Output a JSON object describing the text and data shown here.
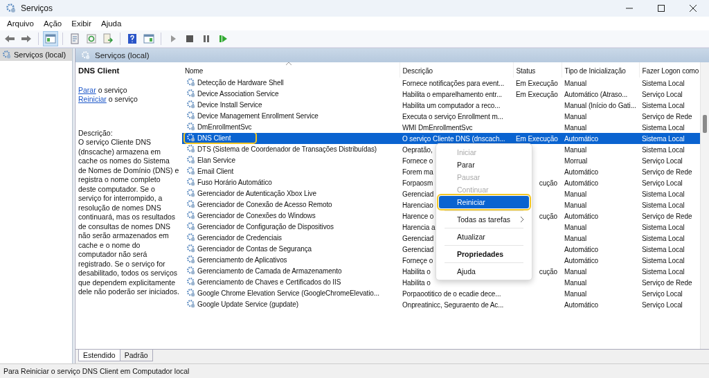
{
  "window": {
    "title": "Serviços"
  },
  "menu_bar": [
    "Arquivo",
    "Ação",
    "Exibir",
    "Ajuda"
  ],
  "tree": {
    "items": [
      {
        "label": "Serviços (local)",
        "selected": true
      }
    ]
  },
  "pane_header": "Serviços (local)",
  "details": {
    "title": "DNS Client",
    "actions": [
      {
        "link": "Parar",
        "text": "o serviço"
      },
      {
        "link": "Reiniciar",
        "text": "o serviço"
      }
    ],
    "description_label": "Descrição:",
    "description": "O serviço Cliente DNS (dnscache) armazena em cache os nomes do Sistema de Nomes de Domínio (DNS) e registra o nome completo deste computador. Se o serviço for interrompido, a resolução de nomes DNS continuará, mas os resultados de consultas de nomes DNS não serão armazenados em cache e o nome do computador não será registrado. Se o serviço for desabilitado, todos os serviços que dependem explicitamente dele não poderão ser iniciados."
  },
  "table": {
    "columns": [
      "Nome",
      "Descrição",
      "Status",
      "Tipo de Inicialização",
      "Fazer Logon como"
    ],
    "rows": [
      {
        "name": "Detecção de Hardware Shell",
        "description": "Fornece notificações para event...",
        "status": "Em Execução",
        "startup": "Manual",
        "logon": "Sistema Local",
        "selected": false
      },
      {
        "name": "Device Association Service",
        "description": "Habilita o emparelhamento entr...",
        "status": "Em Execução",
        "startup": "Automático (Atraso...",
        "logon": "Serviço Local",
        "selected": false
      },
      {
        "name": "Device Install Service",
        "description": "Habilita um computador a reco...",
        "startup": "Manual (Início do Gati...",
        "logon": "Sistema Local",
        "selected": false
      },
      {
        "name": "Device Management Enrollment Service",
        "description": "Executa o serviço Enrollment m...",
        "startup": "Manual",
        "logon": "Serviço de Rede",
        "selected": false
      },
      {
        "name": "DmEnrollmentSvc",
        "description": "WMI DmEnrollmentSvc",
        "startup": "Manual",
        "logon": "Sistema Local",
        "selected": false
      },
      {
        "name": "DNS Client",
        "description": "O serviço Cliente DNS (dnscach...",
        "status": "Em Execução",
        "startup": "Automático",
        "logon": "Sistema Local",
        "selected": true
      },
      {
        "name": "DTS (Sistema de Coordenador de Transações Distribuídas)",
        "description": "Oepratão,",
        "startup": "Manual",
        "logon": "Sistema Local",
        "selected": false
      },
      {
        "name": "Elan Service",
        "description": "Fornece o",
        "startup": "Morrual",
        "logon": "Serviço Local",
        "selected": false
      },
      {
        "name": "Email Client",
        "description": "Forem ma",
        "startup": "Automático",
        "logon": "Serviço de Rede",
        "selected": false
      },
      {
        "name": "Fuso Horário Automático",
        "description": "Forpaosm",
        "status": "cução",
        "startup": "Automático",
        "logon": "Serviço Local",
        "selected": false
      },
      {
        "name": "Gerenciador de Autenticação Xbox Live",
        "description": "Gerenciad",
        "startup": "Manual",
        "logon": "Sistema Local",
        "selected": false
      },
      {
        "name": "Gerenciador de Conexão de Acesso Remoto",
        "description": "Harenciao",
        "startup": "Manual",
        "logon": "Sistema Local",
        "selected": false
      },
      {
        "name": "Gerenciador de Conexões do Windows",
        "description": "Harence o",
        "status": "cução",
        "startup": "Automático",
        "logon": "Serviço de Rede",
        "selected": false
      },
      {
        "name": "Gerenciador de Configuração de Dispositivos",
        "description": "Harencia a",
        "startup": "Manual",
        "logon": "Sistema Local",
        "selected": false
      },
      {
        "name": "Gerenciador de Credenciais",
        "description": "Gerenciad",
        "startup": "Manual",
        "logon": "Sistema Local",
        "selected": false
      },
      {
        "name": "Gerenciador de Contas de Segurança",
        "description": "Gerenciad",
        "startup": "Automático",
        "logon": "Sistema Local",
        "selected": false
      },
      {
        "name": "Gerenciamento de Aplicativos",
        "description": "Forneçe o",
        "startup": "Automático",
        "logon": "Sistema Local",
        "selected": false
      },
      {
        "name": "Gerenciamento de Camada de Armazenamento",
        "description": "Habilita o",
        "status": "cução",
        "startup": "Manual",
        "logon": "Sistema Local",
        "selected": false
      },
      {
        "name": "Gerenciamento de Chaves e Certificados do IIS",
        "description": "Habilita o",
        "startup": "Manual",
        "logon": "Serviço de Rede",
        "selected": false
      },
      {
        "name": "Google Chrome Elevation Service (GoogleChromeElevatio...",
        "description": "Porpaootitico de o ecadie dece...",
        "startup": "Manual",
        "logon": "Serviço Local",
        "selected": false
      },
      {
        "name": "Google Update Service (gupdate)",
        "description": "Onpreatinicc, Seguraento de Ac...",
        "startup": "Automático",
        "logon": "Serviço Local",
        "selected": false
      }
    ]
  },
  "context_menu": [
    {
      "kind": "item",
      "label": "Iniciar",
      "disabled": true,
      "selected": false,
      "default": false,
      "submenu": false
    },
    {
      "kind": "item",
      "label": "Parar",
      "disabled": false,
      "selected": false,
      "default": false,
      "submenu": false
    },
    {
      "kind": "item",
      "label": "Pausar",
      "disabled": true,
      "selected": false,
      "default": false,
      "submenu": false
    },
    {
      "kind": "item",
      "label": "Continuar",
      "disabled": true,
      "selected": false,
      "default": false,
      "submenu": false
    },
    {
      "kind": "item",
      "label": "Reiniciar",
      "disabled": false,
      "selected": true,
      "default": false,
      "submenu": false
    },
    {
      "kind": "separator"
    },
    {
      "kind": "item",
      "label": "Todas as tarefas",
      "disabled": false,
      "selected": false,
      "default": false,
      "submenu": true
    },
    {
      "kind": "separator"
    },
    {
      "kind": "item",
      "label": "Atualizar",
      "disabled": false,
      "selected": false,
      "default": false,
      "submenu": false
    },
    {
      "kind": "separator"
    },
    {
      "kind": "item",
      "label": "Propriedades",
      "disabled": false,
      "selected": false,
      "default": true,
      "submenu": false
    },
    {
      "kind": "separator"
    },
    {
      "kind": "item",
      "label": "Ajuda",
      "disabled": false,
      "selected": false,
      "default": false,
      "submenu": false
    }
  ],
  "view_tabs": [
    {
      "label": "Estendido",
      "selected": true
    },
    {
      "label": "Padrão",
      "selected": false
    }
  ],
  "status_bar": "Para Reiniciar o serviço DNS Client em Computador local"
}
